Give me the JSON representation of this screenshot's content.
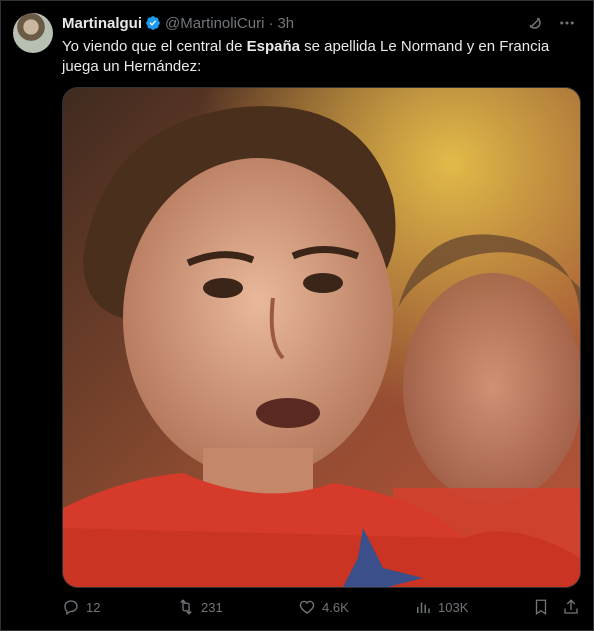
{
  "author": {
    "display_name": "Martinalgui",
    "handle": "@MartinoliCuri",
    "time": "3h",
    "verified": true
  },
  "tweet": {
    "text_part1": "Yo viendo que el central de ",
    "text_bold": "España",
    "text_part2": " se apellida Le Normand y en Francia juega un Hernández:"
  },
  "media": {
    "icon": "photo"
  },
  "stats": {
    "replies": "12",
    "retweets": "231",
    "likes": "4.6K",
    "views": "103K"
  },
  "colors": {
    "background": "#000000",
    "text": "#e7e9ea",
    "muted": "#71767b",
    "verified": "#1d9bf0",
    "border": "#2f3336"
  },
  "icons": {
    "grok": "grok-icon",
    "more": "more-icon",
    "reply": "reply-icon",
    "retweet": "retweet-icon",
    "like": "heart-icon",
    "views": "views-icon",
    "bookmark": "bookmark-icon",
    "share": "share-icon"
  }
}
